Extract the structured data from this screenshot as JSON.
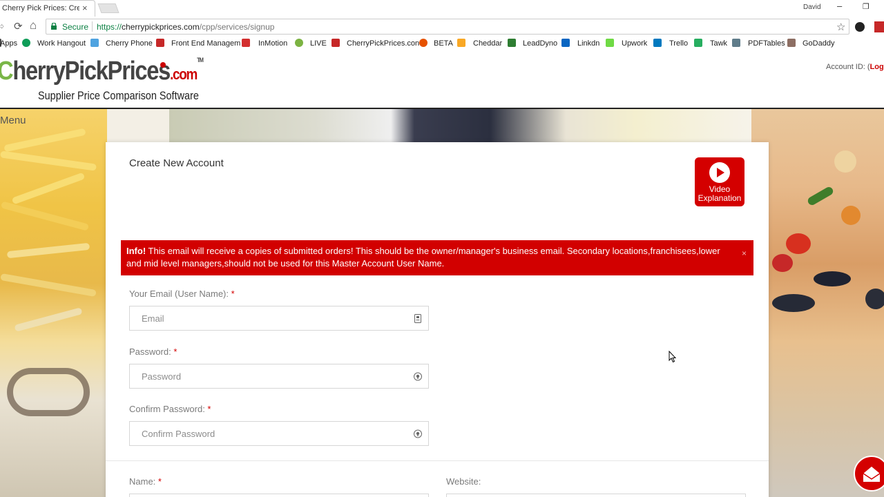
{
  "browser": {
    "tab_title": "Cherry Pick Prices: Create",
    "tab_close": "×",
    "profile_name": "David",
    "window_minimize": "–",
    "window_restore": "❐",
    "back_glyph": "⇨",
    "reload_glyph": "⟳",
    "home_glyph": "⌂",
    "secure_label": "Secure",
    "url_scheme": "https://",
    "url_host": "cherrypickprices.com",
    "url_path": "/cpp/services/signup",
    "star_glyph": "☆"
  },
  "bookmarks": [
    {
      "label": "Apps",
      "icon": "apps-icon",
      "color": "#4a4a4a"
    },
    {
      "label": "Work Hangout",
      "icon": "hangout-icon",
      "color": "#0f9d58"
    },
    {
      "label": "Cherry Phone",
      "icon": "phone-icon",
      "color": "#4fa3e0"
    },
    {
      "label": "Front End Managem",
      "icon": "cherry-icon",
      "color": "#c62828"
    },
    {
      "label": "InMotion",
      "icon": "inmotion-icon",
      "color": "#d32f2f"
    },
    {
      "label": "LIVE",
      "icon": "live-icon",
      "color": "#7cb342"
    },
    {
      "label": "CherryPickPrices.con",
      "icon": "cherry-icon",
      "color": "#c62828"
    },
    {
      "label": "BETA",
      "icon": "beta-icon",
      "color": "#e65100"
    },
    {
      "label": "Cheddar",
      "icon": "cheddar-icon",
      "color": "#f9a825"
    },
    {
      "label": "LeadDyno",
      "icon": "leaddyno-icon",
      "color": "#2e7d32"
    },
    {
      "label": "Linkdn",
      "icon": "linkedin-icon",
      "color": "#0a66c2"
    },
    {
      "label": "Upwork",
      "icon": "upwork-icon",
      "color": "#6fda44"
    },
    {
      "label": "Trello",
      "icon": "trello-icon",
      "color": "#0079bf"
    },
    {
      "label": "Tawk",
      "icon": "tawk-icon",
      "color": "#27ae60"
    },
    {
      "label": "PDFTables",
      "icon": "pdftables-icon",
      "color": "#607d8b"
    },
    {
      "label": "GoDaddy",
      "icon": "godaddy-icon",
      "color": "#8d6e63"
    }
  ],
  "site": {
    "logo_c": "C",
    "logo_text": "herryPickPrices",
    "logo_com": ".com",
    "logo_tm": "TM",
    "tagline": "Supplier Price Comparison Software",
    "account_id_label": "Account ID: (",
    "logout_label": "Logout",
    "menu_label": "Menu"
  },
  "form": {
    "title": "Create New Account",
    "video_line1": "Video",
    "video_line2": "Explanation",
    "info_strong": "Info!",
    "info_text": " This email will receive a copies of submitted orders! This should be the owner/manager's business email. Secondary locations,franchisees,lower and mid level managers,should not be used for this Master Account User Name.",
    "info_close": "×",
    "required_mark": "*",
    "email_label": "Your Email (User Name): ",
    "email_placeholder": "Email",
    "password_label": "Password: ",
    "password_placeholder": "Password",
    "confirm_label": "Confirm Password: ",
    "confirm_placeholder": "Confirm Password",
    "name_label": "Name: ",
    "website_label": "Website:"
  },
  "colors": {
    "brand_red": "#d40000",
    "brand_green": "#7ab648",
    "secure_green": "#0b8043"
  }
}
